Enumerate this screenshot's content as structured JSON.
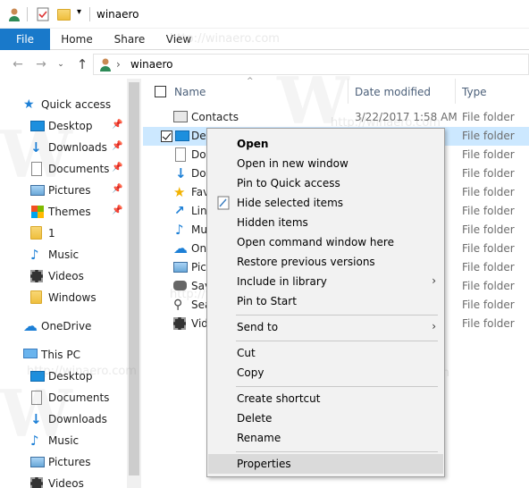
{
  "window": {
    "title": "winaero"
  },
  "ribbon": {
    "tabs": [
      "File",
      "Home",
      "Share",
      "View"
    ]
  },
  "address": {
    "path": "winaero"
  },
  "nav": {
    "quick_access": "Quick access",
    "qa_items": [
      "Desktop",
      "Downloads",
      "Documents",
      "Pictures",
      "Themes",
      "1",
      "Music",
      "Videos",
      "Windows"
    ],
    "onedrive": "OneDrive",
    "thispc": "This PC",
    "pc_items": [
      "Desktop",
      "Documents",
      "Downloads",
      "Music",
      "Pictures",
      "Videos"
    ]
  },
  "columns": {
    "name": "Name",
    "date": "Date modified",
    "type": "Type"
  },
  "files": [
    {
      "name": "Contacts",
      "date": "3/22/2017 1:58 AM",
      "type": "File folder"
    },
    {
      "name": "De",
      "date": "",
      "type": "File folder"
    },
    {
      "name": "Do",
      "date": "",
      "type": "File folder"
    },
    {
      "name": "Do",
      "date": "",
      "type": "File folder"
    },
    {
      "name": "Fav",
      "date": "",
      "type": "File folder"
    },
    {
      "name": "Lin",
      "date": "",
      "type": "File folder"
    },
    {
      "name": "Mu",
      "date": "",
      "type": "File folder"
    },
    {
      "name": "On",
      "date": "",
      "type": "File folder"
    },
    {
      "name": "Pic",
      "date": "",
      "type": "File folder"
    },
    {
      "name": "Sav",
      "date": "",
      "type": "File folder"
    },
    {
      "name": "Sea",
      "date": "",
      "type": "File folder"
    },
    {
      "name": "Vid",
      "date": "",
      "type": "File folder"
    }
  ],
  "menu": {
    "open": "Open",
    "open_new": "Open in new window",
    "pin_qa": "Pin to Quick access",
    "hide": "Hide selected items",
    "hidden": "Hidden items",
    "cmd": "Open command window here",
    "restore": "Restore previous versions",
    "library": "Include in library",
    "pin_start": "Pin to Start",
    "sendto": "Send to",
    "cut": "Cut",
    "copy": "Copy",
    "shortcut": "Create shortcut",
    "delete": "Delete",
    "rename": "Rename",
    "properties": "Properties"
  },
  "watermark": "http://winaero.com",
  "colors": {
    "file_tab": "#1979ca",
    "selection": "#cce8ff",
    "menu_bg": "#f2f2f2"
  }
}
